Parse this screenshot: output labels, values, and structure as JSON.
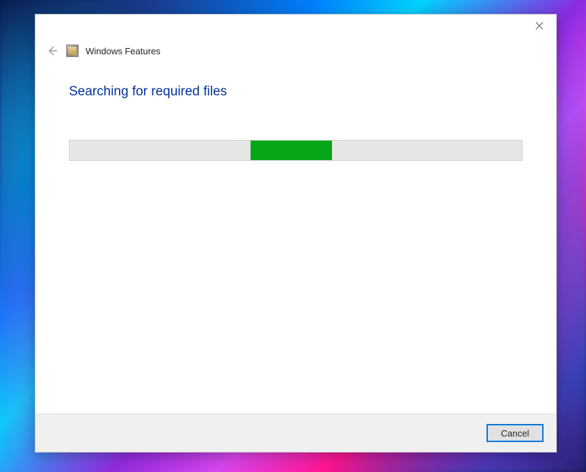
{
  "window": {
    "title": "Windows Features"
  },
  "main": {
    "heading": "Searching for required files"
  },
  "progress": {
    "indeterminate_start_percent": 40,
    "indeterminate_width_percent": 18,
    "fill_color": "#06a717"
  },
  "footer": {
    "cancel_label": "Cancel"
  }
}
